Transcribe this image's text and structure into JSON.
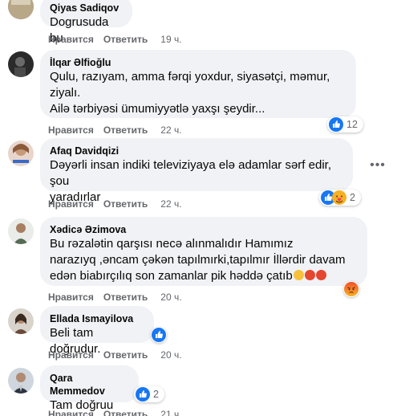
{
  "comments": [
    {
      "author": "Qiyas Sadiqov",
      "lines": [
        "Dogrusuda bu"
      ],
      "like": "Нравится",
      "reply": "Ответить",
      "time": "19 ч."
    },
    {
      "author": "İlqar Əlfioğlu",
      "lines": [
        "Qulu, razıyam, amma fərqi yoxdur, siyasətçi, məmur,",
        "ziyalı.",
        "Ailə tərbiyəsi ümumiyyətlə yaxşı şeydir..."
      ],
      "like": "Нравится",
      "reply": "Ответить",
      "time": "22 ч.",
      "reaction_count": "12"
    },
    {
      "author": "Afaq Davidqizi",
      "lines": [
        "Dəyərli insan indiki televiziyaya elə adamlar sərf edir, şou",
        "yaradırlar"
      ],
      "like": "Нравится",
      "reply": "Ответить",
      "time": "22 ч.",
      "reaction_count": "2"
    },
    {
      "author": "Xədicə Əzimova",
      "lines": [
        "Bu rəzalətin qarşısı necə alınmalıdır Hamımız",
        "narazıyq ,əncam çəkən tapılmırki,tapılmır İllərdir davam",
        "edən biabırçılıq son zamanlar pik həddə çatıb"
      ],
      "like": "Нравится",
      "reply": "Ответить",
      "time": "20 ч."
    },
    {
      "author": "Ellada Ismayilova",
      "lines": [
        "Beli tam doğrudur."
      ],
      "like": "Нравится",
      "reply": "Ответить",
      "time": "20 ч."
    },
    {
      "author": "Qara Memmedov",
      "lines": [
        "Tam doğruu"
      ],
      "like": "Нравится",
      "reply": "Ответить",
      "time": "21 ч.",
      "reaction_count": "2"
    }
  ],
  "colors": {
    "bubble": "#f0f2f5",
    "like_blue": "#1877f2",
    "angry_orange": "#f0522b",
    "meta_gray": "#65676b"
  },
  "icons": [
    "like-icon",
    "care-icon",
    "angry-icon",
    "more-options-icon"
  ]
}
